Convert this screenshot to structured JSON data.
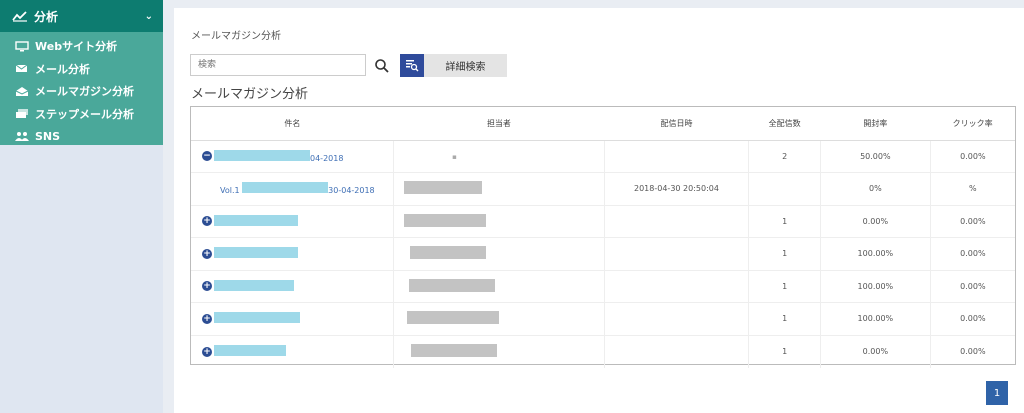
{
  "sidebar": {
    "header": {
      "label": "分析",
      "icon": "chart-line-icon"
    },
    "items": [
      {
        "label": "Webサイト分析",
        "icon": "monitor-icon"
      },
      {
        "label": "メール分析",
        "icon": "envelope-icon"
      },
      {
        "label": "メールマガジン分析",
        "icon": "envelope-open-icon"
      },
      {
        "label": "ステップメール分析",
        "icon": "envelope-step-icon"
      },
      {
        "label": "SNS",
        "icon": "users-icon"
      }
    ]
  },
  "main": {
    "breadcrumb": "メールマガジン分析",
    "search": {
      "placeholder": "検索"
    },
    "advanced_search_label": "詳細検索",
    "section_title": "メールマガジン分析",
    "table": {
      "headers": [
        "件名",
        "担当者",
        "配信日時",
        "全配信数",
        "開封率",
        "クリック率"
      ],
      "rows": [
        {
          "toggle": "−",
          "name_suffix": "04-2018",
          "user": "▪",
          "date": "",
          "total": "2",
          "open": "50.00%",
          "click": "0.00%"
        },
        {
          "toggle": "",
          "name_prefix": "Vol.1",
          "name_suffix": "30-04-2018",
          "user": "",
          "date": "2018-04-30 20:50:04",
          "total": "",
          "open": "0%",
          "click": "%"
        },
        {
          "toggle": "+",
          "name_suffix": "",
          "user": "",
          "date": "",
          "total": "1",
          "open": "0.00%",
          "click": "0.00%"
        },
        {
          "toggle": "+",
          "name_suffix": "",
          "user": "",
          "date": "",
          "total": "1",
          "open": "100.00%",
          "click": "0.00%"
        },
        {
          "toggle": "+",
          "name_suffix": "",
          "user": "",
          "date": "",
          "total": "1",
          "open": "100.00%",
          "click": "0.00%"
        },
        {
          "toggle": "+",
          "name_suffix": "",
          "user": "",
          "date": "",
          "total": "1",
          "open": "100.00%",
          "click": "0.00%"
        },
        {
          "toggle": "+",
          "name_suffix": "",
          "user": "",
          "date": "",
          "total": "1",
          "open": "0.00%",
          "click": "0.00%"
        }
      ]
    },
    "pagination": {
      "current": "1"
    }
  },
  "colors": {
    "sidebar_header": "#0d7c70",
    "sidebar_menu": "#4aa89a",
    "accent": "#2f4b9b",
    "link": "#3f6fb5"
  }
}
